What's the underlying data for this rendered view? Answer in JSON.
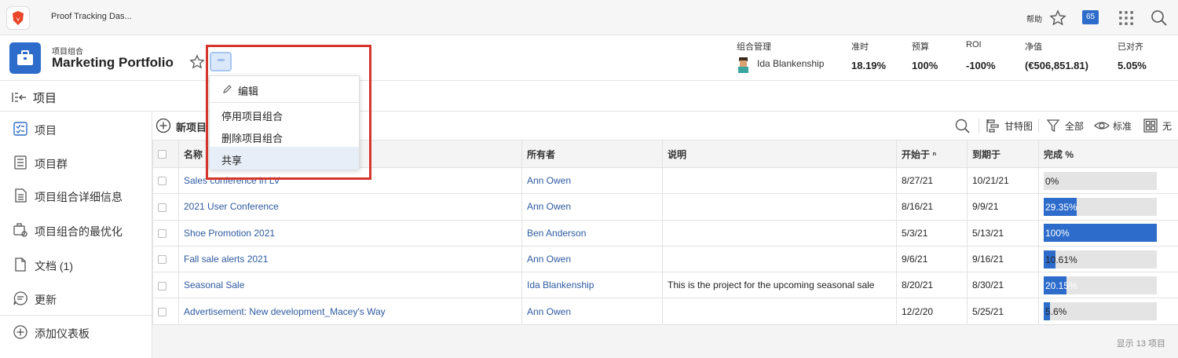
{
  "topbar": {
    "app_title": "Proof Tracking Das...",
    "help": "帮助",
    "notification_count": "65"
  },
  "header": {
    "label": "项目组合",
    "title": "Marketing Portfolio",
    "more_label": "◦◦◦",
    "stats": {
      "manager_label": "组合管理",
      "manager_name": "Ida Blankenship",
      "ontime_label": "准时",
      "ontime_value": "18.19%",
      "budget_label": "预算",
      "budget_value": "100%",
      "roi_label": "ROI",
      "roi_value": "-100%",
      "net_label": "净值",
      "net_value": "(€506,851.81)",
      "aligned_label": "已对齐",
      "aligned_value": "5.05%"
    }
  },
  "section": {
    "title": "项目"
  },
  "sidebar": {
    "items": [
      {
        "label": "项目",
        "icon": "project-list-icon"
      },
      {
        "label": "项目群",
        "icon": "program-icon"
      },
      {
        "label": "项目组合详细信息",
        "icon": "details-icon"
      },
      {
        "label": "项目组合的最优化",
        "icon": "optimizer-icon"
      },
      {
        "label": "文档 (1)",
        "icon": "document-icon"
      },
      {
        "label": "更新",
        "icon": "updates-icon"
      },
      {
        "label": "添加仪表板",
        "icon": "add-icon"
      }
    ]
  },
  "toolbar": {
    "new_label": "新项目",
    "gantt": "甘特图",
    "filter": "全部",
    "view": "标准",
    "group": "无"
  },
  "table": {
    "headers": {
      "name": "名称",
      "owner": "所有者",
      "description": "说明",
      "start": "开始于 ⁿ",
      "due": "到期于",
      "complete": "完成 %"
    },
    "rows": [
      {
        "name": "Sales conference in LV",
        "owner": "Ann Owen",
        "description": "",
        "start": "8/27/21",
        "due": "10/21/21",
        "complete_label": "0%",
        "complete": 0
      },
      {
        "name": "2021 User Conference",
        "owner": "Ann Owen",
        "description": "",
        "start": "8/16/21",
        "due": "9/9/21",
        "complete_label": "29.35%",
        "complete": 29.35
      },
      {
        "name": "Shoe Promotion 2021",
        "owner": "Ben Anderson",
        "description": "",
        "start": "5/3/21",
        "due": "5/13/21",
        "complete_label": "100%",
        "complete": 100
      },
      {
        "name": "Fall sale alerts 2021",
        "owner": "Ann Owen",
        "description": "",
        "start": "9/6/21",
        "due": "9/16/21",
        "complete_label": "10.61%",
        "complete": 10.61
      },
      {
        "name": "Seasonal Sale",
        "owner": "Ida Blankenship",
        "description": "This is the project for the upcoming seasonal sale",
        "start": "8/20/21",
        "due": "8/30/21",
        "complete_label": "20.15%",
        "complete": 20.15
      },
      {
        "name": "Advertisement: New development_Macey's Way",
        "owner": "Ann Owen",
        "description": "",
        "start": "12/2/20",
        "due": "5/25/21",
        "complete_label": "5.6%",
        "complete": 5.6
      }
    ],
    "footer": "显示 13 项目"
  },
  "menu": {
    "edit": "编辑",
    "deactivate": "停用项目组合",
    "delete": "删除项目组合",
    "share": "共享"
  },
  "colors": {
    "accent": "#2d6ccb",
    "highlight": "#d5362b"
  }
}
